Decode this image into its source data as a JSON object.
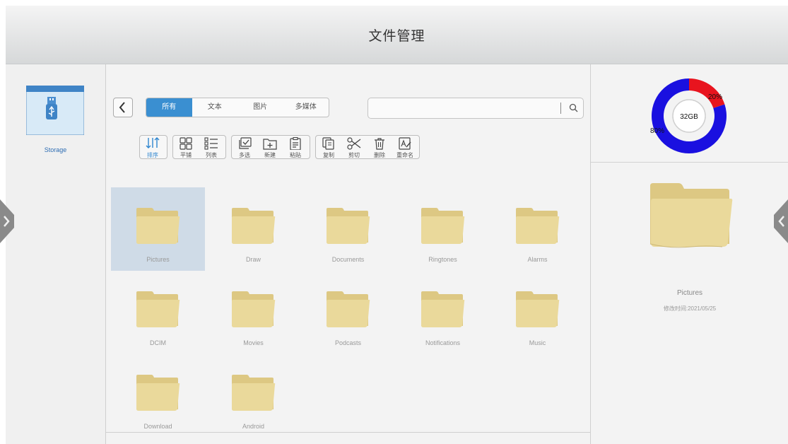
{
  "window": {
    "title": "文件管理"
  },
  "sidebar": {
    "storage_label": "Storage"
  },
  "tabs": [
    {
      "label": "所有",
      "active": true
    },
    {
      "label": "文本",
      "active": false
    },
    {
      "label": "图片",
      "active": false
    },
    {
      "label": "多媒体",
      "active": false
    }
  ],
  "search": {
    "value": "",
    "placeholder": ""
  },
  "toolbar": {
    "sort": "排序",
    "tile": "平铺",
    "list": "列表",
    "multiselect": "多选",
    "new": "新建",
    "paste": "粘贴",
    "copy": "复制",
    "cut": "剪切",
    "delete": "删除",
    "rename": "重命名"
  },
  "files": [
    {
      "name": "Pictures",
      "selected": true
    },
    {
      "name": "Draw"
    },
    {
      "name": "Documents"
    },
    {
      "name": "Ringtones"
    },
    {
      "name": "Alarms"
    },
    {
      "name": "DCIM"
    },
    {
      "name": "Movies"
    },
    {
      "name": "Podcasts"
    },
    {
      "name": "Notifications"
    },
    {
      "name": "Music"
    },
    {
      "name": "Download"
    },
    {
      "name": "Android"
    }
  ],
  "storage_chart": {
    "total_label": "32GB",
    "used_percent_label": "20%",
    "free_percent_label": "80%",
    "used_percent": 20,
    "used_color": "#e8141e",
    "free_color": "#1a10e0"
  },
  "detail": {
    "name": "Pictures",
    "modified": "修改时间:2021/05/25"
  },
  "colors": {
    "accent": "#3a8fd1",
    "folder": "#e9d79a",
    "selection": "#cfdbe7"
  }
}
